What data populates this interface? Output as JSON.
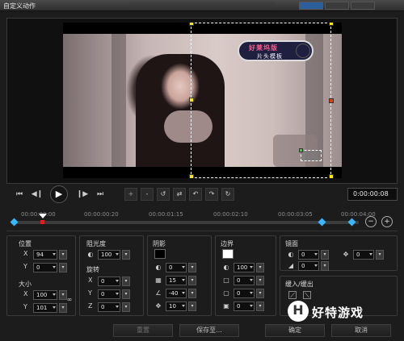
{
  "window": {
    "title": "自定义动作"
  },
  "preview": {
    "caption_line1": "好莱坞版",
    "caption_line2": "片头模板"
  },
  "transport": {
    "timecode": "0:00:00:08"
  },
  "ruler": {
    "ticks": [
      "00:00:00:00",
      "00:00:00:20",
      "00:00:01:15",
      "00:00:02:10",
      "00:00:03:05",
      "00:00:04:00"
    ]
  },
  "panels": {
    "position": {
      "label": "位置",
      "x_label": "X",
      "x_value": "94",
      "y_label": "Y",
      "y_value": "0"
    },
    "size": {
      "label": "大小",
      "x_label": "X",
      "x_value": "100",
      "y_label": "Y",
      "y_value": "101"
    },
    "opacity": {
      "label": "阻光度",
      "value": "100"
    },
    "rotation": {
      "label": "旋转",
      "x_label": "X",
      "x_value": "0",
      "y_label": "Y",
      "y_value": "0",
      "z_label": "Z",
      "z_value": "0"
    },
    "shadow": {
      "label": "阴影",
      "color": "#000000",
      "opacity_value": "0",
      "blur_value": "15",
      "angle_value": "-40",
      "distance_value": "10"
    },
    "border": {
      "label": "边界",
      "color": "#ffffff",
      "opacity_value": "100",
      "width_value": "0",
      "blur_value": "0",
      "transparency_value": "0"
    },
    "mirror": {
      "label": "镜面",
      "opacity_value": "0",
      "extra_value": "0",
      "angle_value": "0"
    },
    "fade": {
      "label": "缓入/缓出"
    }
  },
  "buttons": {
    "reset": "重置",
    "save_as": "保存至...",
    "ok": "确定",
    "cancel": "取消"
  },
  "watermark": {
    "glyph": "H",
    "text": "好特游戏"
  }
}
